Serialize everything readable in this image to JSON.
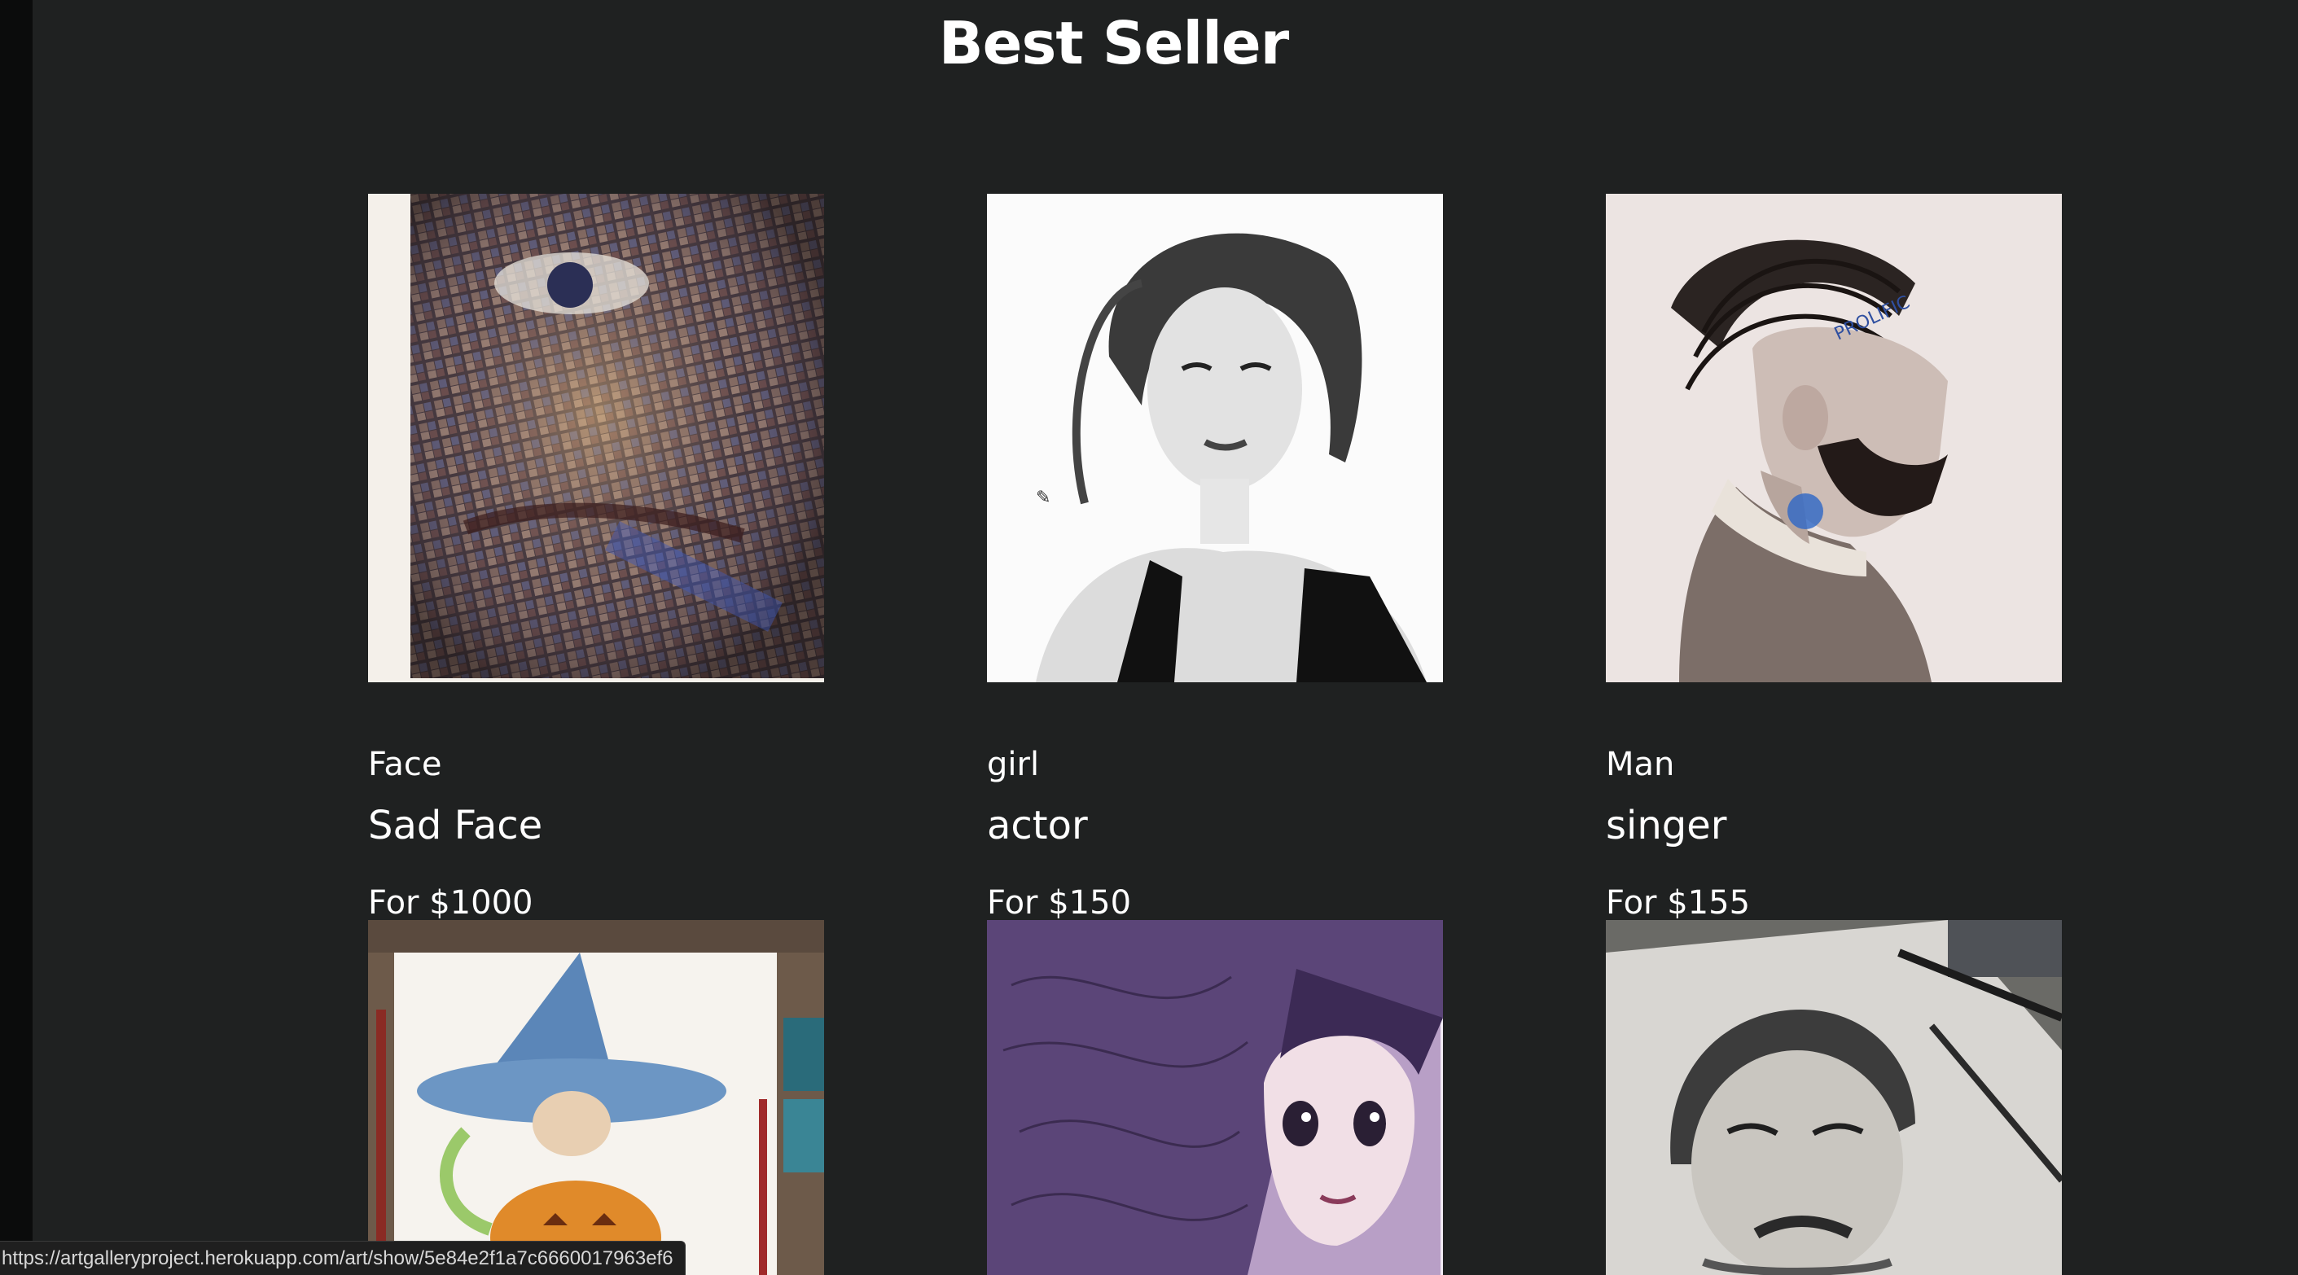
{
  "page": {
    "title": "Best Seller"
  },
  "artworks": [
    {
      "category": "Face",
      "name": "Sad Face",
      "price": "For $1000",
      "image": "mosaic-face-artwork"
    },
    {
      "category": "girl",
      "name": "actor",
      "price": "For $150",
      "image": "pencil-portrait-woman-artwork"
    },
    {
      "category": "Man",
      "name": "singer",
      "price": "For $155",
      "image": "braided-man-portrait-artwork"
    },
    {
      "category": "",
      "name": "",
      "price": "",
      "image": "witch-watercolor-artwork"
    },
    {
      "category": "",
      "name": "",
      "price": "",
      "image": "purple-girl-illustration-artwork"
    },
    {
      "category": "",
      "name": "",
      "price": "",
      "image": "pencil-sketch-man-artwork"
    }
  ],
  "status_bar": {
    "url": "https://artgalleryproject.herokuapp.com/art/show/5e84e2f1a7c6660017963ef6"
  },
  "colors": {
    "page_background": "#1f2121",
    "text": "#ffffff"
  }
}
